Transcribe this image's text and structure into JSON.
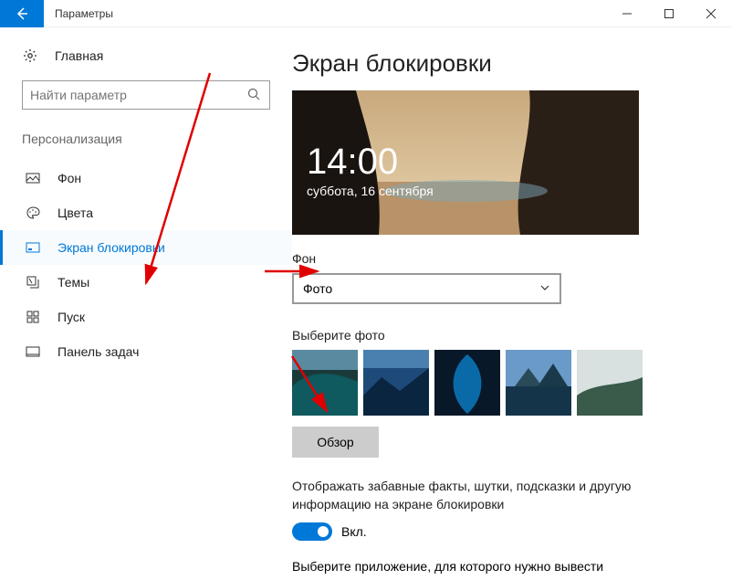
{
  "window": {
    "title": "Параметры"
  },
  "sidebar": {
    "home_label": "Главная",
    "search_placeholder": "Найти параметр",
    "category_label": "Персонализация",
    "items": [
      {
        "label": "Фон"
      },
      {
        "label": "Цвета"
      },
      {
        "label": "Экран блокировки"
      },
      {
        "label": "Темы"
      },
      {
        "label": "Пуск"
      },
      {
        "label": "Панель задач"
      }
    ]
  },
  "main": {
    "page_title": "Экран блокировки",
    "preview_time": "14:00",
    "preview_date": "суббота, 16 сентября",
    "background_label": "Фон",
    "background_value": "Фото",
    "choose_photo_label": "Выберите фото",
    "browse_label": "Обзор",
    "fun_facts_desc": "Отображать забавные факты, шутки, подсказки и другую информацию на экране блокировки",
    "toggle_label": "Вкл.",
    "choose_app_label": "Выберите приложение, для которого нужно вывести"
  }
}
